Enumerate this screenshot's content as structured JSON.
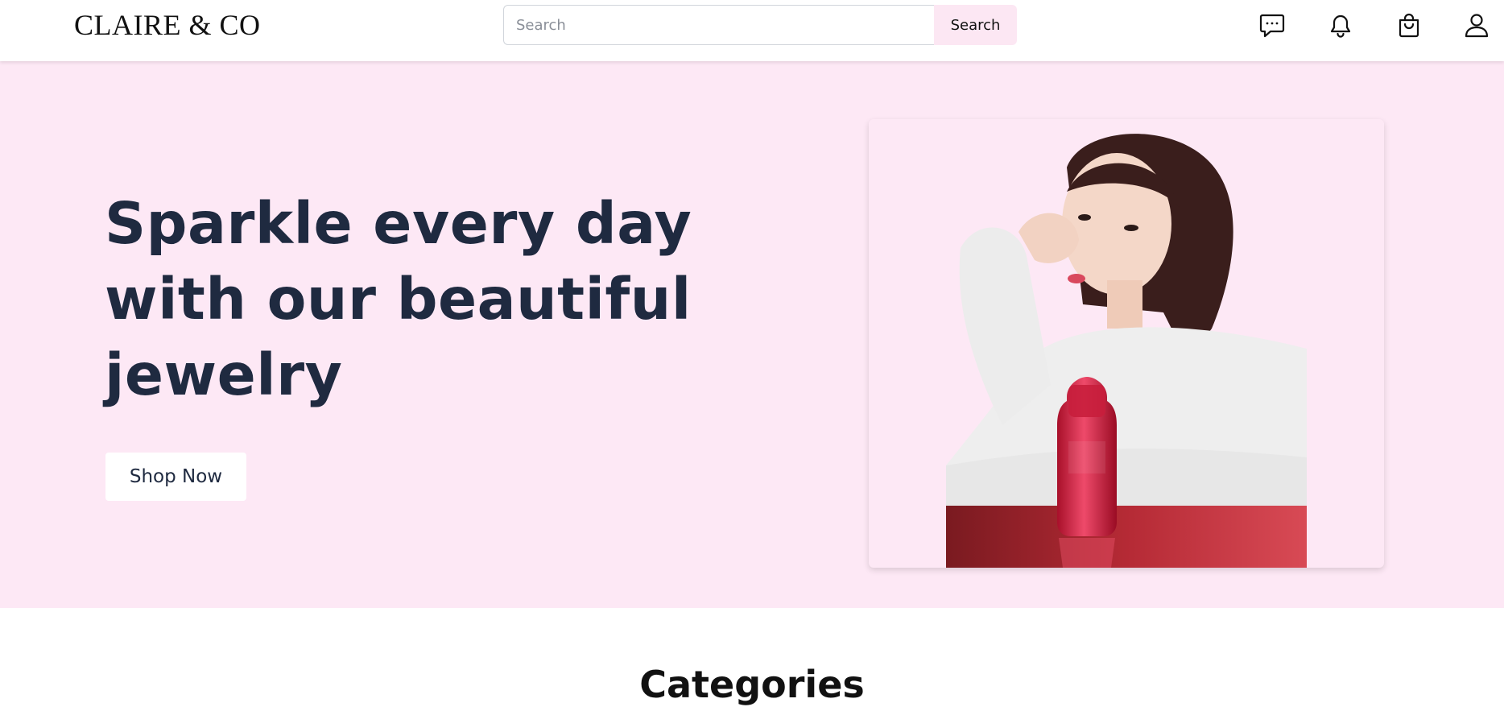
{
  "header": {
    "logo": "CLAIRE & CO",
    "search": {
      "placeholder": "Search",
      "value": "",
      "button_label": "Search"
    },
    "icons": [
      "chat-icon",
      "bell-icon",
      "shopping-bag-icon",
      "user-icon"
    ]
  },
  "hero": {
    "title": "Sparkle every day with our beautiful jewelry",
    "button_label": "Shop Now",
    "image_alt": "Model with serum bottle"
  },
  "categories": {
    "title": "Categories"
  },
  "colors": {
    "hero_background": "#fde8f5",
    "search_button_background": "#fce7f3",
    "headline_text": "#1f2a40"
  }
}
